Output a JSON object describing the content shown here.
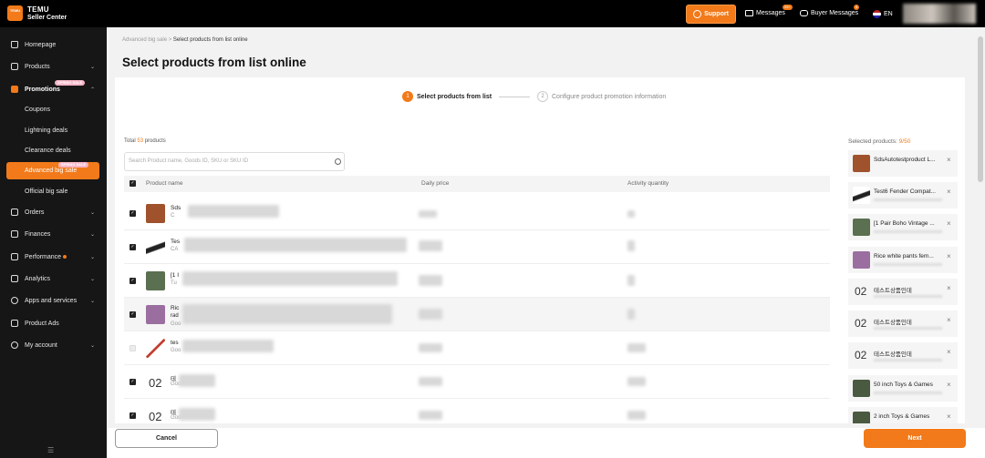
{
  "header": {
    "logo_text": "TEMU",
    "brand_title": "TEMU",
    "brand_subtitle": "Seller Center",
    "support": "Support",
    "messages": "Messages",
    "messages_badge": "99+",
    "buyer_messages": "Buyer Messages",
    "buyer_badge": "8",
    "language": "EN"
  },
  "sidebar": {
    "homepage": "Homepage",
    "products": "Products",
    "promotions": "Promotions",
    "spring_sale": "SPRING SALE",
    "coupons": "Coupons",
    "lightning": "Lightning deals",
    "clearance": "Clearance deals",
    "advanced": "Advanced big sale",
    "official": "Official big sale",
    "orders": "Orders",
    "finances": "Finances",
    "performance": "Performance",
    "analytics": "Analytics",
    "apps": "Apps and services",
    "product_ads": "Product Ads",
    "my_account": "My account",
    "collapse_icon": "menu-collapse-icon"
  },
  "page": {
    "breadcrumb_parent": "Advanced big sale",
    "breadcrumb_sep": ">",
    "breadcrumb_current": "Select products from list online",
    "title": "Select products from list online"
  },
  "steps": {
    "s1_num": "1",
    "s1_label": "Select products from list",
    "s2_num": "2",
    "s2_label": "Configure product promotion information"
  },
  "list": {
    "total_prefix": "Total",
    "total_count": "53",
    "total_suffix": "products",
    "search_placeholder": "Search Product name, Goods ID, SKU or SKU ID",
    "col_name": "Product name",
    "col_price": "Daily price",
    "col_qty": "Activity quantity"
  },
  "rows": [
    {
      "name": "Sds",
      "sub": "C",
      "thumb": "#a0522d"
    },
    {
      "name": "Tes",
      "sub": "CA",
      "thumb": "#222"
    },
    {
      "name": "[1 I",
      "sub": "Tu",
      "thumb": "#5a7050"
    },
    {
      "name": "Ric",
      "sub": "rad",
      "sub2": "Goo",
      "thumb": "#9a6fa0"
    },
    {
      "name": "tes",
      "sub": "Goo",
      "thumb": "#c0392b"
    },
    {
      "name": "테",
      "sub": "Goo",
      "big": "02"
    },
    {
      "name": "테",
      "sub": "Goo",
      "big": "02"
    }
  ],
  "selected": {
    "label": "Selected products:",
    "count": "9/50",
    "items": [
      {
        "name": "SdsAutotestproduct L...",
        "thumb": "#a0522d"
      },
      {
        "name": "Test6 Fender Compat...",
        "thumb": "#222"
      },
      {
        "name": "[1 Pair Boho Vintage ...",
        "thumb": "#5a7050"
      },
      {
        "name": "Rice white pants fem...",
        "thumb": "#9a6fa0"
      },
      {
        "name": "테스트상품인데",
        "big": "02"
      },
      {
        "name": "테스트상품인데",
        "big": "02"
      },
      {
        "name": "테스트상품인데",
        "big": "02"
      },
      {
        "name": "50 inch Toys & Games",
        "thumb": "#4a5a40"
      },
      {
        "name": "2 inch Toys & Games",
        "thumb": "#4a5a40"
      }
    ],
    "remove": "×"
  },
  "footer": {
    "cancel": "Cancel",
    "next": "Next"
  },
  "colors": {
    "accent": "#f27a1a",
    "sidebar_bg": "#161616"
  }
}
